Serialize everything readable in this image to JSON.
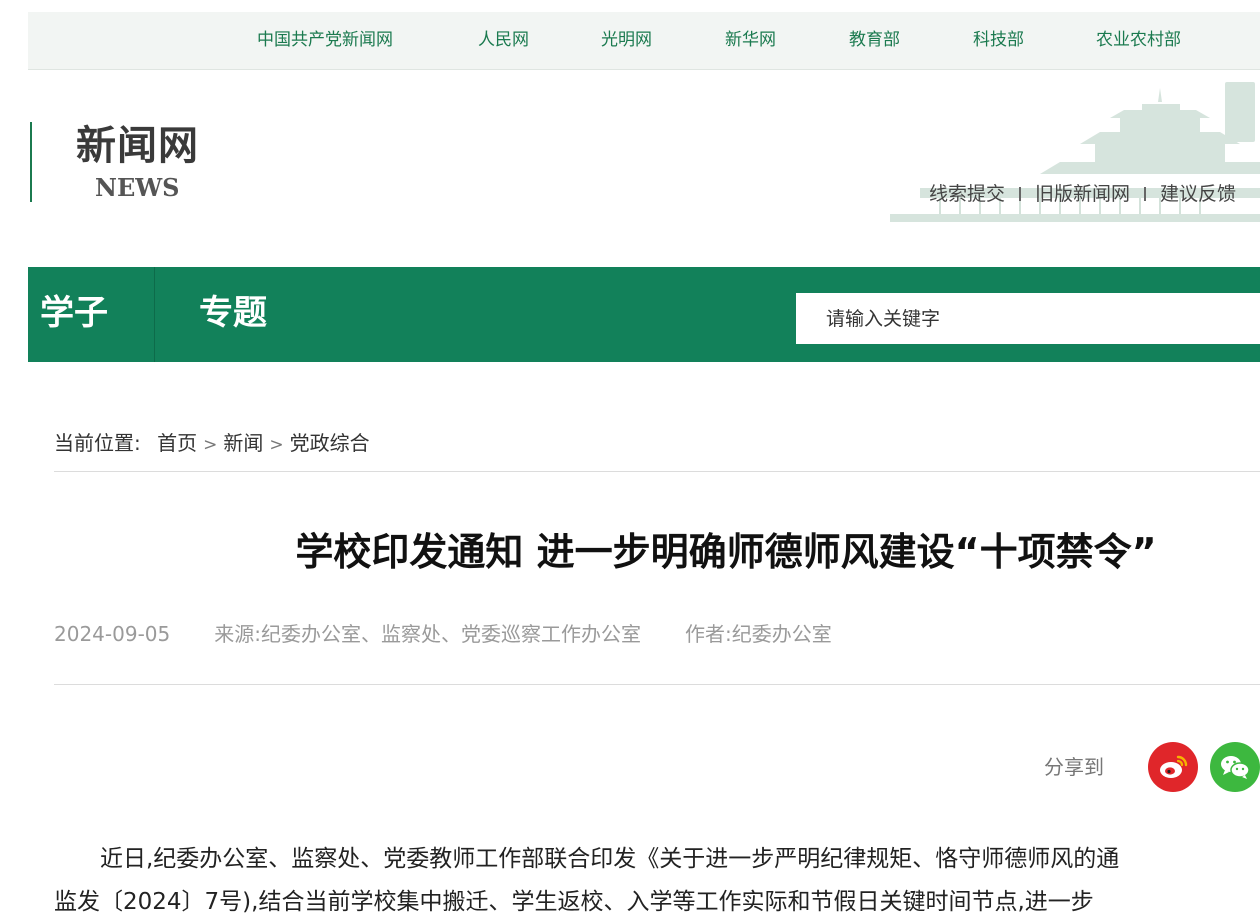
{
  "top_links": [
    "中国共产党新闻网",
    "人民网",
    "光明网",
    "新华网",
    "教育部",
    "科技部",
    "农业农村部"
  ],
  "logo": {
    "cn": "新闻网",
    "en": "NEWS"
  },
  "header_links": [
    "线索提交",
    "旧版新闻网",
    "建议反馈"
  ],
  "nav": {
    "items": [
      "学子",
      "专题"
    ],
    "search_placeholder": "请输入关键字"
  },
  "breadcrumb": {
    "label": "当前位置:",
    "items": [
      "首页",
      "新闻",
      "党政综合"
    ],
    "separator": ">"
  },
  "article": {
    "title": "学校印发通知 进一步明确师德师风建设“十项禁令”",
    "date": "2024-09-05",
    "source": "来源:纪委办公室、监察处、党委巡察工作办公室",
    "author": "作者:纪委办公室",
    "share_label": "分享到",
    "paragraph_lines": [
      "　　近日,纪委办公室、监察处、党委教师工作部联合印发《关于进一步严明纪律规矩、恪守师德师风的通",
      "监发〔2024〕7号),结合当前学校集中搬迁、学生返校、入学等工作实际和节假日关键时间节点,进一步"
    ]
  },
  "colors": {
    "brand_green": "#12815a",
    "link_green": "#1b7a4f",
    "weibo_red": "#e0262a",
    "wechat_green": "#3db83f"
  },
  "icons": {
    "weibo": "weibo-icon",
    "wechat": "wechat-icon"
  }
}
